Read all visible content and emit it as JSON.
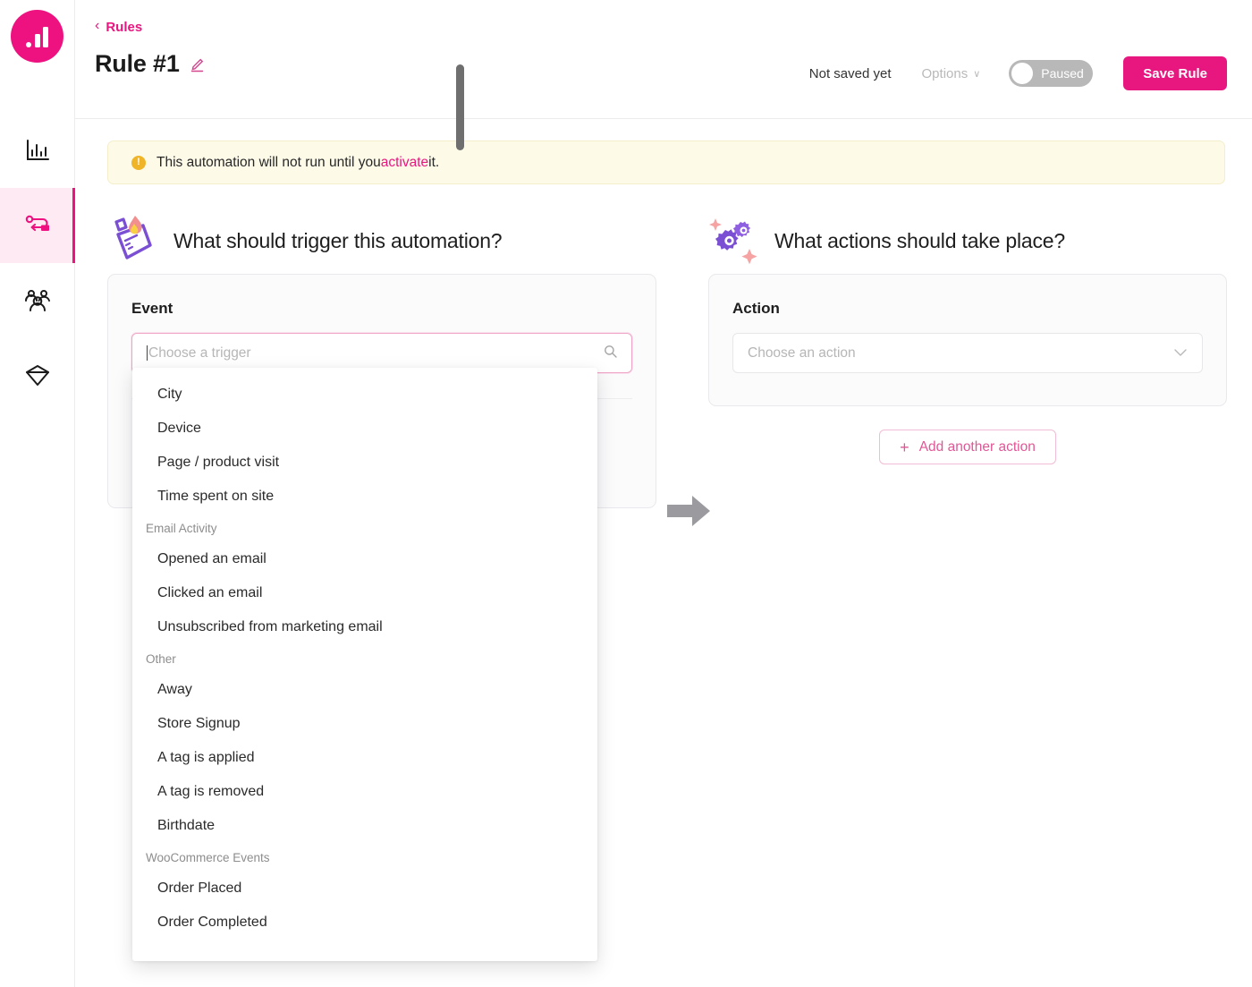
{
  "brand": {
    "accent": "#e8177f",
    "accent_soft": "#fdeaf3",
    "purple": "#7b4fd4"
  },
  "sidebar": {
    "logo_name": "analytics-logo",
    "items": [
      {
        "icon": "bar-chart-icon",
        "name": "reports",
        "active": false
      },
      {
        "icon": "automation-flow-icon",
        "name": "automations",
        "active": true
      },
      {
        "icon": "audience-people-icon",
        "name": "audience",
        "active": false
      },
      {
        "icon": "box-package-icon",
        "name": "products",
        "active": false
      }
    ]
  },
  "header": {
    "breadcrumb_label": "Rules",
    "breadcrumb_chevron": "‹",
    "title": "Rule #1",
    "edit_icon": "pencil-icon",
    "not_saved_label": "Not saved yet",
    "options_label": "Options",
    "options_caret": "∨",
    "toggle_label": "Paused",
    "toggle_state": "off",
    "save_label": "Save Rule"
  },
  "banner": {
    "icon": "warning-icon",
    "icon_glyph": "!",
    "text_before": "This automation will not run until you ",
    "link": "activate",
    "text_after": " it."
  },
  "trigger_section": {
    "illustration": "lighter-flame-icon",
    "heading": "What should trigger this automation?",
    "card_label": "Event",
    "input_placeholder": "Choose a trigger",
    "input_value": "",
    "search_icon": "search-icon"
  },
  "action_section": {
    "illustration": "gears-sparkle-icon",
    "heading": "What actions should take place?",
    "card_label": "Action",
    "select_placeholder": "Choose an action",
    "chevron_icon": "chevron-down-icon",
    "add_action_label": "Add another action",
    "add_action_plus": "+"
  },
  "flow_arrow": {
    "name": "right-arrow-icon"
  },
  "dropdown": {
    "visible": true,
    "scrollbar": {
      "name": "dropdown-scrollbar-thumb"
    },
    "entries": [
      {
        "type": "item",
        "label": "City"
      },
      {
        "type": "item",
        "label": "Device"
      },
      {
        "type": "item",
        "label": "Page / product visit"
      },
      {
        "type": "item",
        "label": "Time spent on site"
      },
      {
        "type": "group",
        "label": "Email Activity"
      },
      {
        "type": "item",
        "label": "Opened an email"
      },
      {
        "type": "item",
        "label": "Clicked an email"
      },
      {
        "type": "item",
        "label": "Unsubscribed from marketing email"
      },
      {
        "type": "group",
        "label": "Other"
      },
      {
        "type": "item",
        "label": "Away"
      },
      {
        "type": "item",
        "label": "Store Signup"
      },
      {
        "type": "item",
        "label": "A tag is applied"
      },
      {
        "type": "item",
        "label": "A tag is removed"
      },
      {
        "type": "item",
        "label": "Birthdate"
      },
      {
        "type": "group",
        "label": "WooCommerce Events"
      },
      {
        "type": "item",
        "label": "Order Placed"
      },
      {
        "type": "item",
        "label": "Order Completed"
      }
    ]
  }
}
